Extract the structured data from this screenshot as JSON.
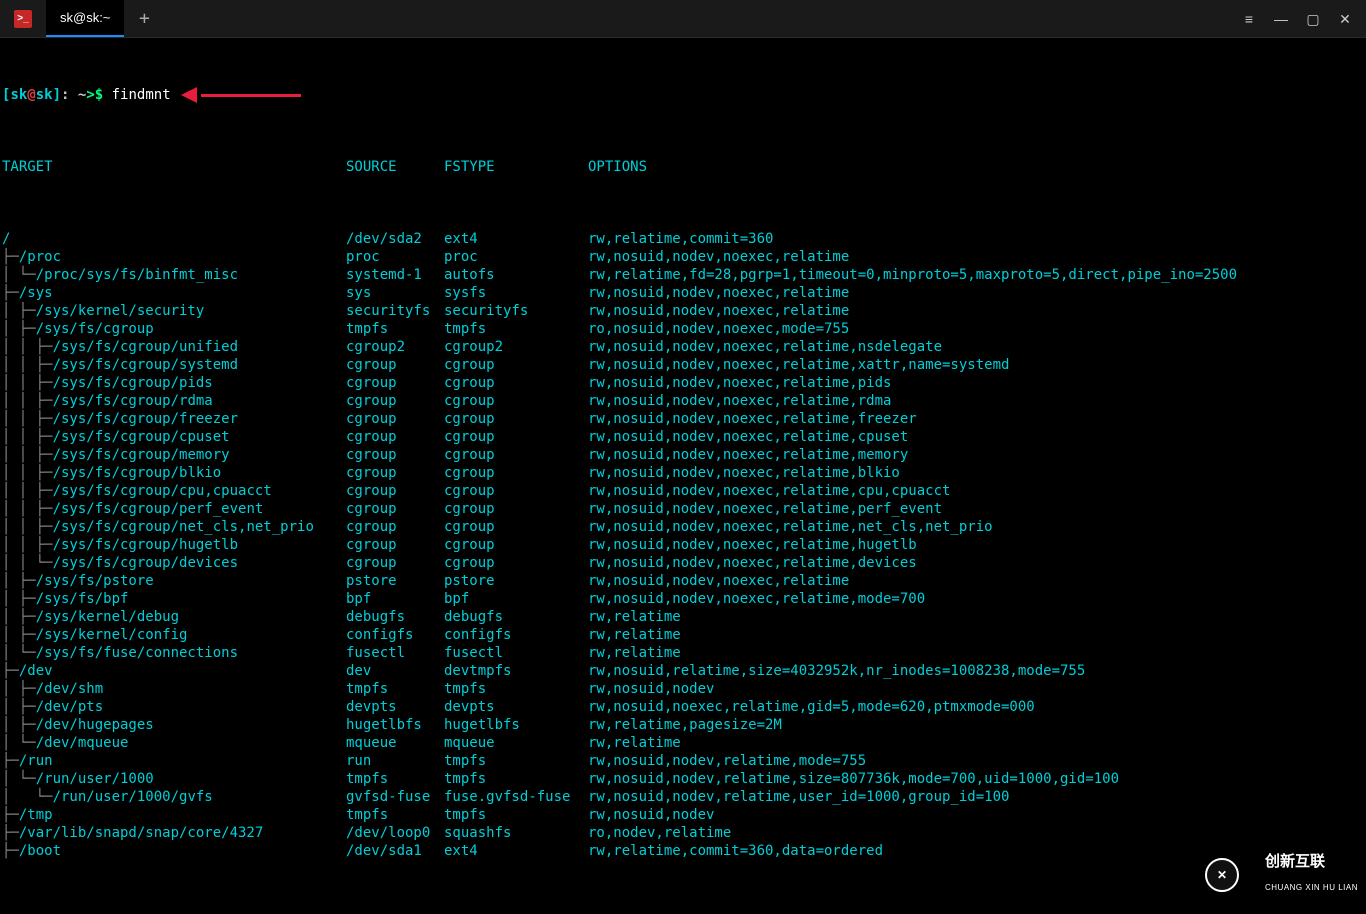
{
  "window": {
    "tab_label": "sk@sk:~",
    "add_tab": "+",
    "controls": {
      "menu": "≡",
      "min": "—",
      "max": "▢",
      "close": "✕"
    }
  },
  "prompt": {
    "lbr": "[",
    "user": "sk",
    "at": "@",
    "host": "sk",
    "rbr": "]",
    "sep": ": ~",
    "arrow": ">",
    "dollar": "$",
    "command": " findmnt"
  },
  "headers": {
    "target": "TARGET",
    "source": "SOURCE",
    "fstype": "FSTYPE",
    "options": "OPTIONS"
  },
  "rows": [
    {
      "d": 0,
      "target": "/",
      "source": "/dev/sda2",
      "fstype": "ext4",
      "options": "rw,relatime,commit=360",
      "root": true
    },
    {
      "d": 1,
      "target": "/proc",
      "source": "proc",
      "fstype": "proc",
      "options": "rw,nosuid,nodev,noexec,relatime"
    },
    {
      "d": 2,
      "target": "/proc/sys/fs/binfmt_misc",
      "source": "systemd-1",
      "fstype": "autofs",
      "options": "rw,relatime,fd=28,pgrp=1,timeout=0,minproto=5,maxproto=5,direct,pipe_ino=2500",
      "last": true
    },
    {
      "d": 1,
      "target": "/sys",
      "source": "sys",
      "fstype": "sysfs",
      "options": "rw,nosuid,nodev,noexec,relatime"
    },
    {
      "d": 2,
      "target": "/sys/kernel/security",
      "source": "securityfs",
      "fstype": "securityfs",
      "options": "rw,nosuid,nodev,noexec,relatime"
    },
    {
      "d": 2,
      "target": "/sys/fs/cgroup",
      "source": "tmpfs",
      "fstype": "tmpfs",
      "options": "ro,nosuid,nodev,noexec,mode=755"
    },
    {
      "d": 3,
      "target": "/sys/fs/cgroup/unified",
      "source": "cgroup2",
      "fstype": "cgroup2",
      "options": "rw,nosuid,nodev,noexec,relatime,nsdelegate"
    },
    {
      "d": 3,
      "target": "/sys/fs/cgroup/systemd",
      "source": "cgroup",
      "fstype": "cgroup",
      "options": "rw,nosuid,nodev,noexec,relatime,xattr,name=systemd"
    },
    {
      "d": 3,
      "target": "/sys/fs/cgroup/pids",
      "source": "cgroup",
      "fstype": "cgroup",
      "options": "rw,nosuid,nodev,noexec,relatime,pids"
    },
    {
      "d": 3,
      "target": "/sys/fs/cgroup/rdma",
      "source": "cgroup",
      "fstype": "cgroup",
      "options": "rw,nosuid,nodev,noexec,relatime,rdma"
    },
    {
      "d": 3,
      "target": "/sys/fs/cgroup/freezer",
      "source": "cgroup",
      "fstype": "cgroup",
      "options": "rw,nosuid,nodev,noexec,relatime,freezer"
    },
    {
      "d": 3,
      "target": "/sys/fs/cgroup/cpuset",
      "source": "cgroup",
      "fstype": "cgroup",
      "options": "rw,nosuid,nodev,noexec,relatime,cpuset"
    },
    {
      "d": 3,
      "target": "/sys/fs/cgroup/memory",
      "source": "cgroup",
      "fstype": "cgroup",
      "options": "rw,nosuid,nodev,noexec,relatime,memory"
    },
    {
      "d": 3,
      "target": "/sys/fs/cgroup/blkio",
      "source": "cgroup",
      "fstype": "cgroup",
      "options": "rw,nosuid,nodev,noexec,relatime,blkio"
    },
    {
      "d": 3,
      "target": "/sys/fs/cgroup/cpu,cpuacct",
      "source": "cgroup",
      "fstype": "cgroup",
      "options": "rw,nosuid,nodev,noexec,relatime,cpu,cpuacct"
    },
    {
      "d": 3,
      "target": "/sys/fs/cgroup/perf_event",
      "source": "cgroup",
      "fstype": "cgroup",
      "options": "rw,nosuid,nodev,noexec,relatime,perf_event"
    },
    {
      "d": 3,
      "target": "/sys/fs/cgroup/net_cls,net_prio",
      "source": "cgroup",
      "fstype": "cgroup",
      "options": "rw,nosuid,nodev,noexec,relatime,net_cls,net_prio"
    },
    {
      "d": 3,
      "target": "/sys/fs/cgroup/hugetlb",
      "source": "cgroup",
      "fstype": "cgroup",
      "options": "rw,nosuid,nodev,noexec,relatime,hugetlb"
    },
    {
      "d": 3,
      "target": "/sys/fs/cgroup/devices",
      "source": "cgroup",
      "fstype": "cgroup",
      "options": "rw,nosuid,nodev,noexec,relatime,devices",
      "last": true
    },
    {
      "d": 2,
      "target": "/sys/fs/pstore",
      "source": "pstore",
      "fstype": "pstore",
      "options": "rw,nosuid,nodev,noexec,relatime"
    },
    {
      "d": 2,
      "target": "/sys/fs/bpf",
      "source": "bpf",
      "fstype": "bpf",
      "options": "rw,nosuid,nodev,noexec,relatime,mode=700"
    },
    {
      "d": 2,
      "target": "/sys/kernel/debug",
      "source": "debugfs",
      "fstype": "debugfs",
      "options": "rw,relatime"
    },
    {
      "d": 2,
      "target": "/sys/kernel/config",
      "source": "configfs",
      "fstype": "configfs",
      "options": "rw,relatime"
    },
    {
      "d": 2,
      "target": "/sys/fs/fuse/connections",
      "source": "fusectl",
      "fstype": "fusectl",
      "options": "rw,relatime",
      "last": true
    },
    {
      "d": 1,
      "target": "/dev",
      "source": "dev",
      "fstype": "devtmpfs",
      "options": "rw,nosuid,relatime,size=4032952k,nr_inodes=1008238,mode=755"
    },
    {
      "d": 2,
      "target": "/dev/shm",
      "source": "tmpfs",
      "fstype": "tmpfs",
      "options": "rw,nosuid,nodev"
    },
    {
      "d": 2,
      "target": "/dev/pts",
      "source": "devpts",
      "fstype": "devpts",
      "options": "rw,nosuid,noexec,relatime,gid=5,mode=620,ptmxmode=000"
    },
    {
      "d": 2,
      "target": "/dev/hugepages",
      "source": "hugetlbfs",
      "fstype": "hugetlbfs",
      "options": "rw,relatime,pagesize=2M"
    },
    {
      "d": 2,
      "target": "/dev/mqueue",
      "source": "mqueue",
      "fstype": "mqueue",
      "options": "rw,relatime",
      "last": true
    },
    {
      "d": 1,
      "target": "/run",
      "source": "run",
      "fstype": "tmpfs",
      "options": "rw,nosuid,nodev,relatime,mode=755"
    },
    {
      "d": 2,
      "target": "/run/user/1000",
      "source": "tmpfs",
      "fstype": "tmpfs",
      "options": "rw,nosuid,nodev,relatime,size=807736k,mode=700,uid=1000,gid=100",
      "last": true
    },
    {
      "d": 3,
      "target": "/run/user/1000/gvfs",
      "source": "gvfsd-fuse",
      "fstype": "fuse.gvfsd-fuse",
      "options": "rw,nosuid,nodev,relatime,user_id=1000,group_id=100",
      "last": true,
      "pempty": true
    },
    {
      "d": 1,
      "target": "/tmp",
      "source": "tmpfs",
      "fstype": "tmpfs",
      "options": "rw,nosuid,nodev"
    },
    {
      "d": 1,
      "target": "/var/lib/snapd/snap/core/4327",
      "source": "/dev/loop0",
      "fstype": "squashfs",
      "options": "ro,nodev,relatime"
    },
    {
      "d": 1,
      "target": "/boot",
      "source": "/dev/sda1",
      "fstype": "ext4",
      "options": "rw,relatime,commit=360,data=ordered"
    }
  ],
  "watermark": {
    "icon": "✕",
    "line1": "创新互联",
    "line2": "CHUANG XIN HU LIAN"
  }
}
